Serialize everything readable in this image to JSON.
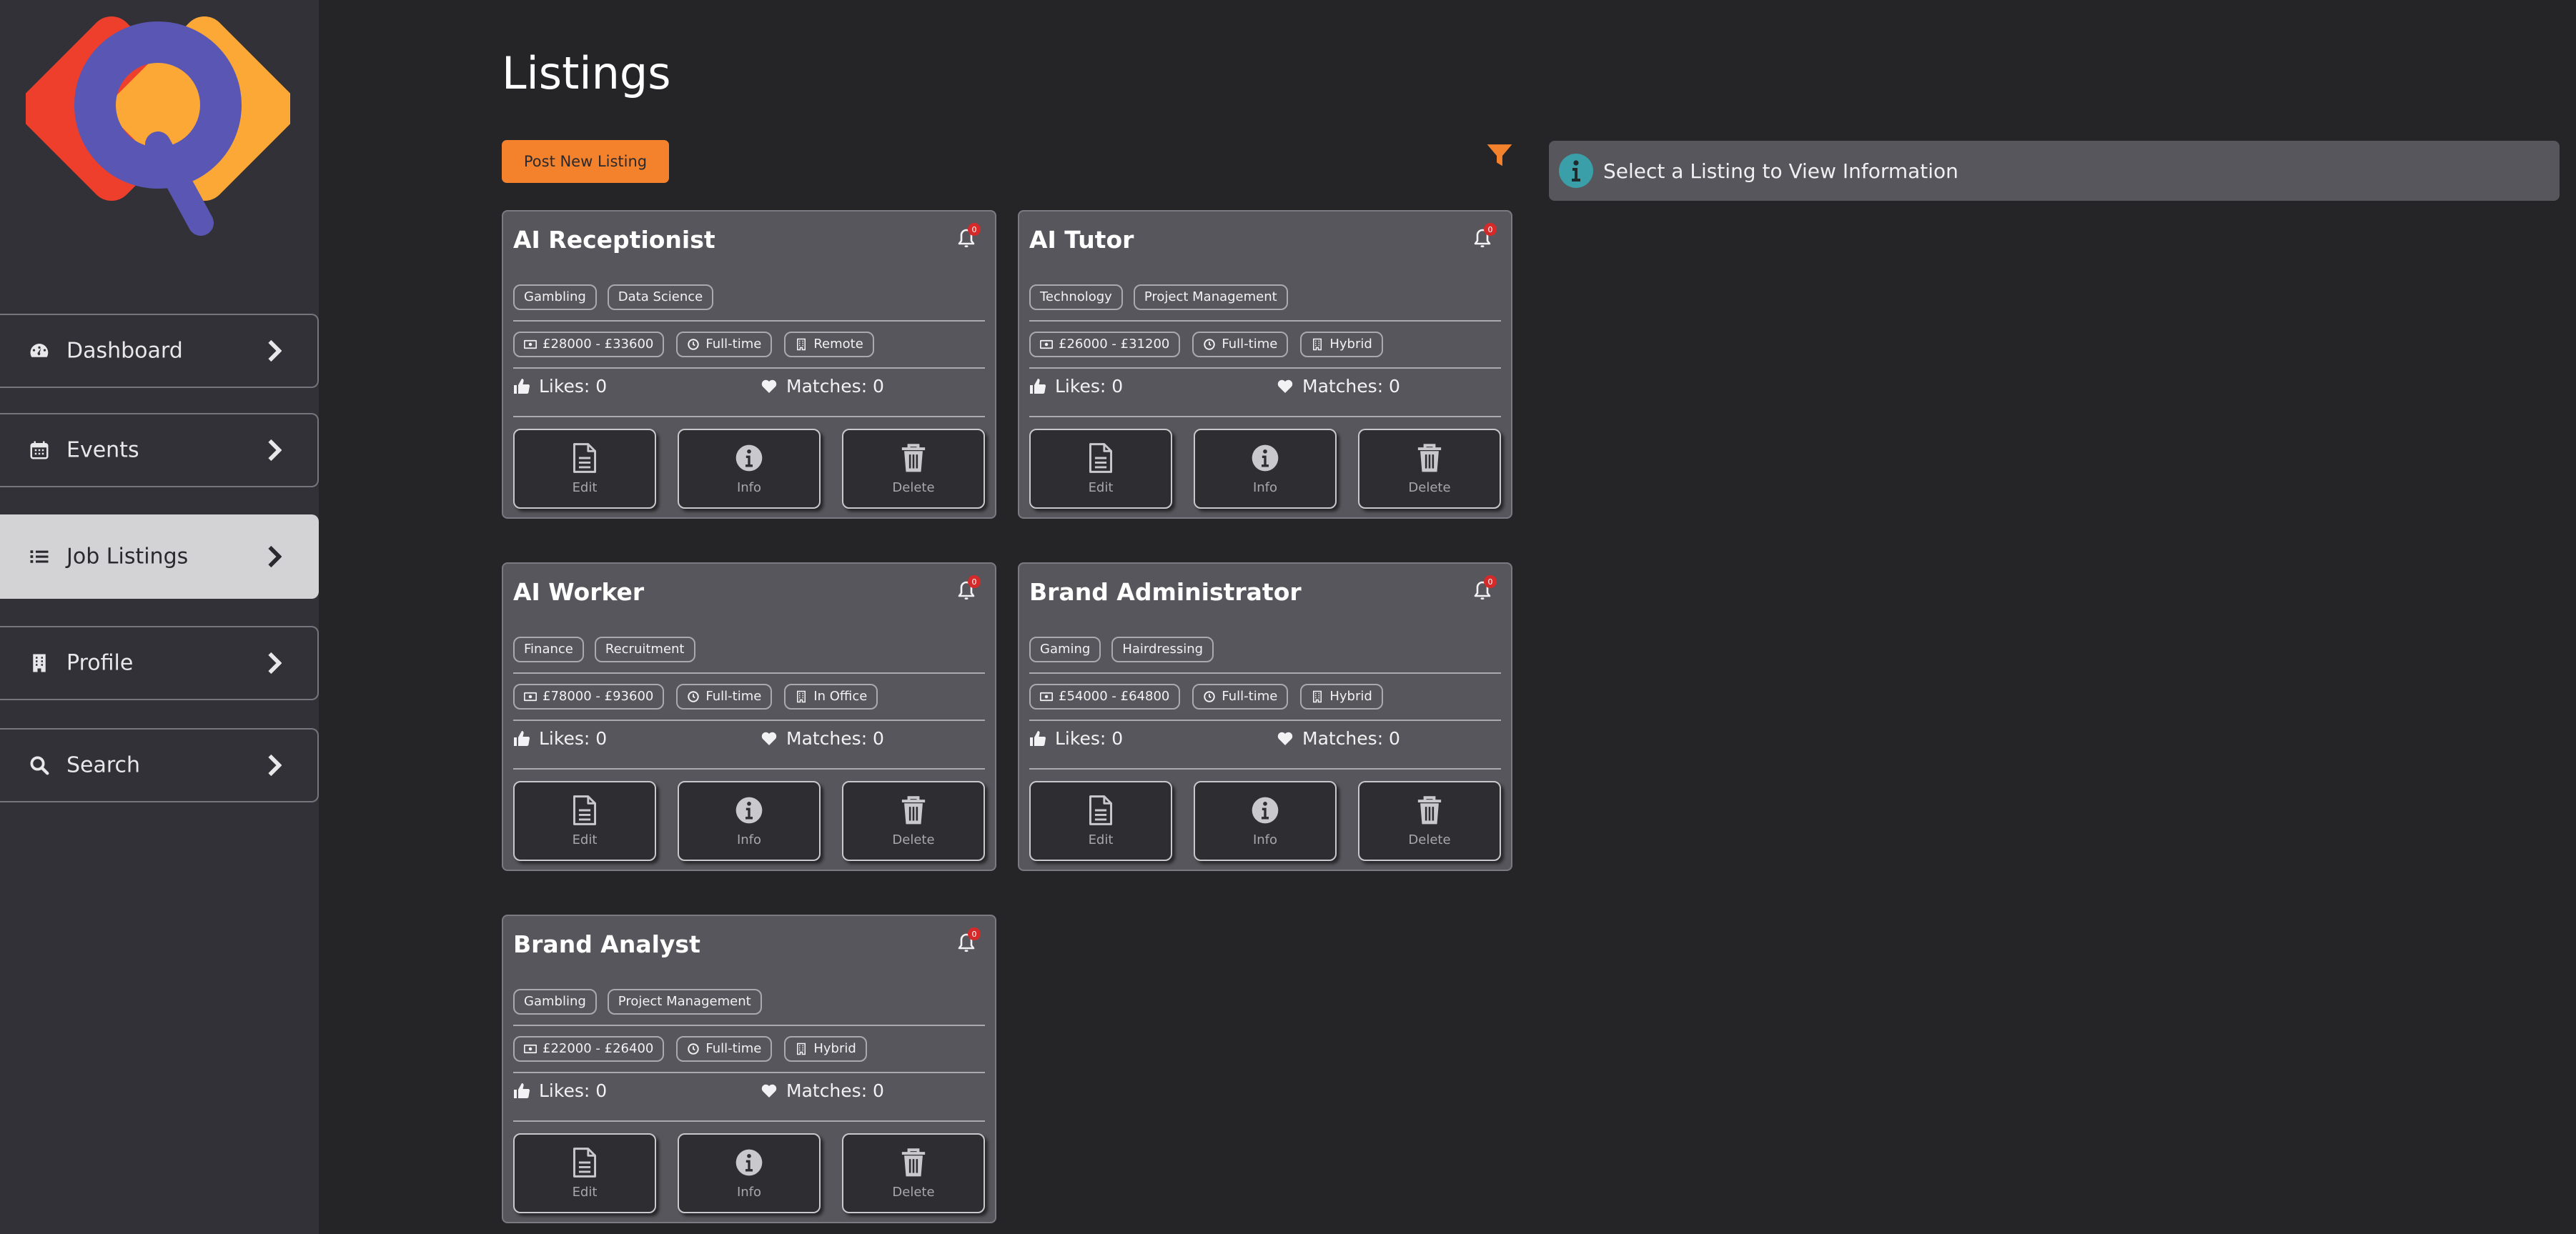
{
  "app": {
    "logo_icon": "magnifier-q-logo"
  },
  "sidebar": {
    "items": [
      {
        "label": "Dashboard",
        "icon": "dashboard-gauge-icon",
        "active": false
      },
      {
        "label": "Events",
        "icon": "calendar-icon",
        "active": false
      },
      {
        "label": "Job Listings",
        "icon": "list-icon",
        "active": true
      },
      {
        "label": "Profile",
        "icon": "building-icon",
        "active": false
      },
      {
        "label": "Search",
        "icon": "search-icon",
        "active": false
      }
    ]
  },
  "main": {
    "title": "Listings",
    "post_button": "Post New Listing",
    "filter_icon": "filter-icon"
  },
  "info_panel": {
    "text": "Select a Listing to View Information",
    "icon": "info-circle-icon"
  },
  "colors": {
    "accent": "#f4812c",
    "info_teal": "#3a9fa8",
    "badge_red": "#d42a2a",
    "card_bg": "#56565c",
    "sidebar_bg": "#313137",
    "page_bg": "#252528"
  },
  "listings": [
    {
      "title": "AI Receptionist",
      "notifications": "0",
      "tags": [
        "Gambling",
        "Data Science"
      ],
      "salary": "£28000 - £33600",
      "type": "Full-time",
      "location": "Remote",
      "likes": "Likes: 0",
      "matches": "Matches: 0",
      "actions": {
        "edit": "Edit",
        "info": "Info",
        "delete": "Delete"
      }
    },
    {
      "title": "AI Tutor",
      "notifications": "0",
      "tags": [
        "Technology",
        "Project Management"
      ],
      "salary": "£26000 - £31200",
      "type": "Full-time",
      "location": "Hybrid",
      "likes": "Likes: 0",
      "matches": "Matches: 0",
      "actions": {
        "edit": "Edit",
        "info": "Info",
        "delete": "Delete"
      }
    },
    {
      "title": "AI Worker",
      "notifications": "0",
      "tags": [
        "Finance",
        "Recruitment"
      ],
      "salary": "£78000 - £93600",
      "type": "Full-time",
      "location": "In Office",
      "likes": "Likes: 0",
      "matches": "Matches: 0",
      "actions": {
        "edit": "Edit",
        "info": "Info",
        "delete": "Delete"
      }
    },
    {
      "title": "Brand Administrator",
      "notifications": "0",
      "tags": [
        "Gaming",
        "Hairdressing"
      ],
      "salary": "£54000 - £64800",
      "type": "Full-time",
      "location": "Hybrid",
      "likes": "Likes: 0",
      "matches": "Matches: 0",
      "actions": {
        "edit": "Edit",
        "info": "Info",
        "delete": "Delete"
      }
    },
    {
      "title": "Brand Analyst",
      "notifications": "0",
      "tags": [
        "Gambling",
        "Project Management"
      ],
      "salary": "£22000 - £26400",
      "type": "Full-time",
      "location": "Hybrid",
      "likes": "Likes: 0",
      "matches": "Matches: 0",
      "actions": {
        "edit": "Edit",
        "info": "Info",
        "delete": "Delete"
      }
    }
  ]
}
